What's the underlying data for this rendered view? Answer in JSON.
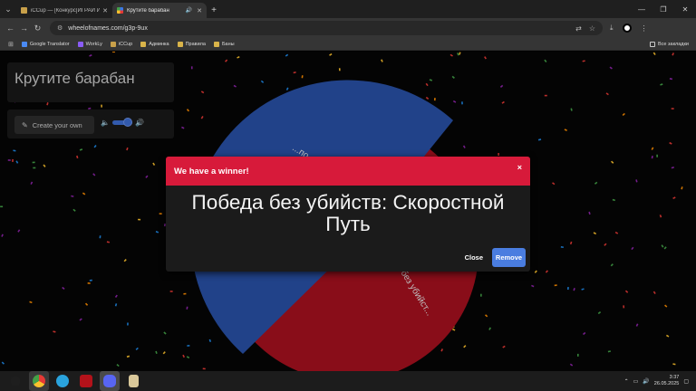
{
  "browser": {
    "tabs": [
      {
        "title": "iCCup — [Конкурс]ИГРАЙ И П...",
        "active": false,
        "sound": false
      },
      {
        "title": "Крутите барабан",
        "active": true,
        "sound": true
      }
    ],
    "url": "wheelofnames.com/g3p-9ux",
    "bookmarks": [
      {
        "label": "Google Translator",
        "icon": "translate-icon",
        "color": "#4a8af4"
      },
      {
        "label": "WorkLy",
        "icon": "workly-icon",
        "color": "#8a5cf6"
      },
      {
        "label": "iCCup",
        "icon": "iccup-icon",
        "color": "#c8a04a"
      },
      {
        "label": "Админка",
        "icon": "folder-icon",
        "color": "#d9b44a"
      },
      {
        "label": "Правила",
        "icon": "folder-icon",
        "color": "#d9b44a"
      },
      {
        "label": "Баны",
        "icon": "folder-icon",
        "color": "#d9b44a"
      }
    ],
    "all_bookmarks_label": "Все закладки"
  },
  "page": {
    "wheel_title": "Крутите барабан",
    "create_button_label": "Create your own",
    "wheel": {
      "blue_color": "#2951a8",
      "red_color": "#a8101f",
      "segment_labels": [
        "...по + тнамед",
        "без убийст..."
      ]
    }
  },
  "dialog": {
    "header": "We have a winner!",
    "close_x": "×",
    "winner": "Победа без убийств: Скоростной Путь",
    "close_label": "Close",
    "remove_label": "Remove",
    "header_color": "#d71a3a",
    "remove_color": "#4a7de0"
  },
  "taskbar": {
    "time": "3:37",
    "date": "26.05.2025"
  }
}
